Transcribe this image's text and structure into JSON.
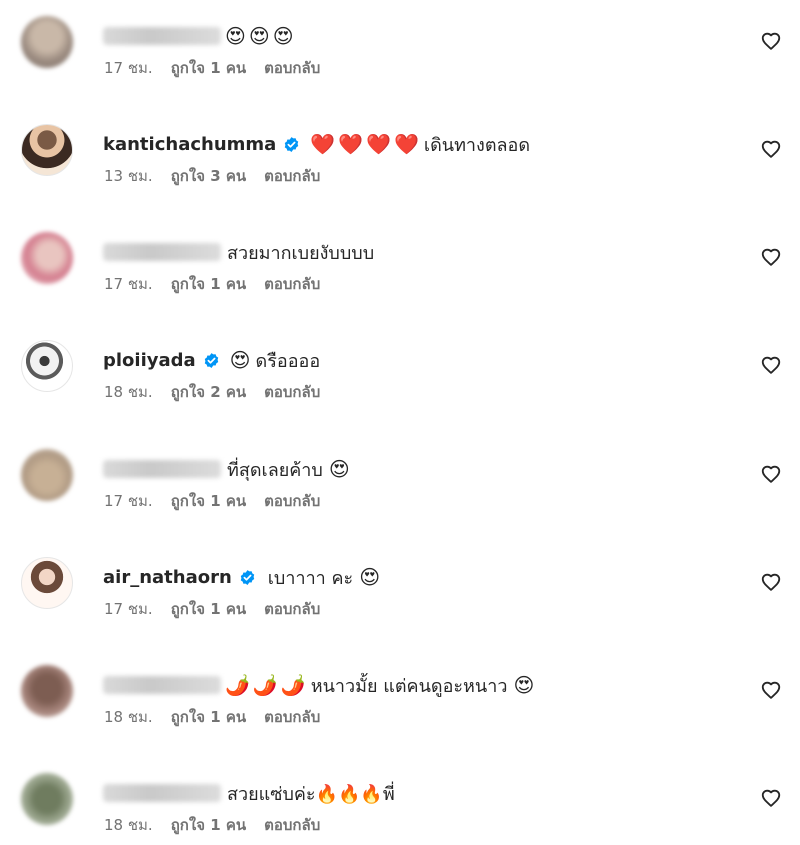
{
  "comments": [
    {
      "username": "",
      "verified": false,
      "emojis_before": [
        "😍",
        "😍",
        "😍"
      ],
      "text": "",
      "emojis_after": [],
      "time": "17 ชม.",
      "likes": "ถูกใจ 1 คน",
      "reply": "ตอบกลับ"
    },
    {
      "username": "kantichachumma",
      "verified": true,
      "emojis_before": [
        "❤️",
        "❤️",
        "❤️",
        "❤️"
      ],
      "text": "เดินทางตลอด",
      "emojis_after": [],
      "time": "13 ชม.",
      "likes": "ถูกใจ 3 คน",
      "reply": "ตอบกลับ"
    },
    {
      "username": "",
      "verified": false,
      "emojis_before": [],
      "text": "สวยมากเบยงับบบบ",
      "emojis_after": [],
      "time": "17 ชม.",
      "likes": "ถูกใจ 1 คน",
      "reply": "ตอบกลับ"
    },
    {
      "username": "ploiiyada",
      "verified": true,
      "emojis_before": [
        "😍"
      ],
      "text": "ดรืออออ",
      "emojis_after": [],
      "time": "18 ชม.",
      "likes": "ถูกใจ 2 คน",
      "reply": "ตอบกลับ"
    },
    {
      "username": "",
      "verified": false,
      "emojis_before": [],
      "text": "ที่สุดเลยค้าบ",
      "emojis_after": [
        "😍"
      ],
      "time": "17 ชม.",
      "likes": "ถูกใจ 1 คน",
      "reply": "ตอบกลับ"
    },
    {
      "username": "air_nathaorn",
      "verified": true,
      "emojis_before": [],
      "text": "เบาาาา คะ",
      "emojis_after": [
        "😍"
      ],
      "time": "17 ชม.",
      "likes": "ถูกใจ 1 คน",
      "reply": "ตอบกลับ"
    },
    {
      "username": "",
      "verified": false,
      "emojis_before": [
        "🌶️",
        "🌶️",
        "🌶️"
      ],
      "text": "หนาวมั้ย แต่คนดูอะหนาว",
      "emojis_after": [
        "😍"
      ],
      "time": "18 ชม.",
      "likes": "ถูกใจ 1 คน",
      "reply": "ตอบกลับ"
    },
    {
      "username": "",
      "verified": false,
      "emojis_before": [],
      "text": "สวยแซ่บค่ะ🔥🔥🔥พี่",
      "emojis_after": [],
      "time": "18 ชม.",
      "likes": "ถูกใจ 1 คน",
      "reply": "ตอบกลับ"
    }
  ],
  "icons": {
    "like": "heart-outline-icon",
    "verified": "verified-badge-icon"
  },
  "colors": {
    "text": "#262626",
    "meta": "#737373",
    "verified": "#0095f6"
  }
}
